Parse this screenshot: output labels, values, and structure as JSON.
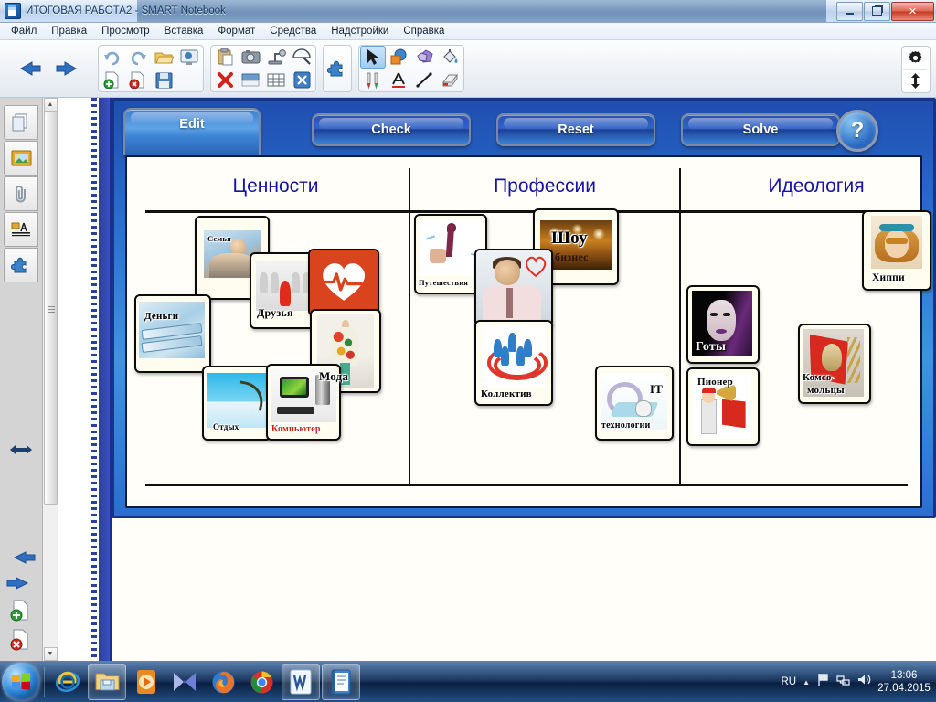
{
  "window": {
    "title": "ИТОГОВАЯ РАБОТА2 - SMART Notebook",
    "app_icon": "notebook-icon",
    "minimize": "–",
    "restore": "❐",
    "close": "✕"
  },
  "menu": {
    "items": [
      {
        "label": "Файл"
      },
      {
        "label": "Правка"
      },
      {
        "label": "Просмотр"
      },
      {
        "label": "Вставка"
      },
      {
        "label": "Формат"
      },
      {
        "label": "Средства"
      },
      {
        "label": "Надстройки"
      },
      {
        "label": "Справка"
      }
    ]
  },
  "toolbar": {
    "groups": [
      {
        "name": "navigation",
        "buttons": [
          "previous-page-arrow",
          "next-page-arrow"
        ]
      },
      {
        "name": "file",
        "buttons": [
          "undo",
          "redo",
          "open",
          "add-page",
          "delete-page",
          "save"
        ]
      },
      {
        "name": "view",
        "buttons": [
          "screen-shade",
          "full-screen"
        ]
      },
      {
        "name": "insert",
        "buttons": [
          "paste",
          "screen-capture",
          "document-camera",
          "measurement-tools",
          "delete",
          "show-hide-screen-shade",
          "table",
          "smart-exchange"
        ]
      },
      {
        "name": "addons",
        "buttons": [
          "add-ons-puzzle"
        ]
      },
      {
        "name": "tools",
        "buttons": [
          "select",
          "shapes",
          "regular-polygons",
          "fill",
          "pens",
          "text",
          "lines",
          "eraser"
        ]
      }
    ],
    "corner": [
      "customize-toolbar-gear",
      "move-toolbar-updown"
    ]
  },
  "sidebar": {
    "tabs": [
      {
        "name": "page-sorter",
        "icon": "pages-icon"
      },
      {
        "name": "gallery",
        "icon": "picture-frame-icon"
      },
      {
        "name": "attachments",
        "icon": "paperclip-icon"
      },
      {
        "name": "properties",
        "icon": "text-properties-icon"
      },
      {
        "name": "add-ons",
        "icon": "puzzle-piece-icon"
      }
    ],
    "resize_handle": "horizontal-resize-icon",
    "bottom": [
      {
        "name": "previous-page",
        "icon": "left-arrow-icon"
      },
      {
        "name": "next-page",
        "icon": "right-arrow-icon"
      },
      {
        "name": "add-page",
        "icon": "page-plus-icon"
      },
      {
        "name": "delete-page",
        "icon": "page-delete-icon"
      }
    ]
  },
  "lesson": {
    "tabs": [
      {
        "label": "Edit",
        "active": true
      },
      {
        "label": "Check",
        "active": false
      },
      {
        "label": "Reset",
        "active": false
      },
      {
        "label": "Solve",
        "active": false
      }
    ],
    "help_label": "?",
    "columns": [
      {
        "title": "Ценности"
      },
      {
        "title": "Профессии"
      },
      {
        "title": "Идеология"
      }
    ],
    "cards": [
      {
        "label": "Семья",
        "art": "t-family",
        "column": 1
      },
      {
        "label": "Друзья",
        "art": "t-friends",
        "column": 1
      },
      {
        "label": "",
        "art": "t-heart",
        "column": 1
      },
      {
        "label": "Деньги",
        "art": "t-money",
        "column": 1
      },
      {
        "label": "Мода",
        "art": "t-moda",
        "column": 1
      },
      {
        "label": "Отдых",
        "art": "t-otdyh",
        "column": 1
      },
      {
        "label": "Компьютер",
        "art": "t-comp",
        "column": 1
      },
      {
        "label": "Путешествия",
        "art": "t-travel",
        "column": 2
      },
      {
        "label": "Шоу-бизнес",
        "art": "t-show",
        "column": 2
      },
      {
        "label": "",
        "art": "t-man",
        "column": 2
      },
      {
        "label": "Коллектив",
        "art": "t-team",
        "column": 2
      },
      {
        "label": "IT технологии",
        "art": "t-it",
        "column": 2
      },
      {
        "label": "Хиппи",
        "art": "t-hippie",
        "column": 3
      },
      {
        "label": "Готы",
        "art": "t-goth",
        "column": 3
      },
      {
        "label": "Комсо-мольцы",
        "art": "t-komsomol",
        "column": 3
      },
      {
        "label": "Пионер",
        "art": "t-pioneer",
        "column": 3
      }
    ],
    "card_text": {
      "family": "Семья",
      "friends": "Друзья",
      "money": "Деньги",
      "moda": "Мода",
      "otdyh": "Отдых",
      "computer": "Компьютер",
      "travel": "Путешествия",
      "show_line1": "Шоу",
      "show_line2": "бизнес",
      "team": "Коллектив",
      "it_line1": "IT",
      "it_line2": "технологии",
      "hippie": "Хиппи",
      "goth": "Готы",
      "komsomol_line1": "Комсо-",
      "komsomol_line2": "мольцы",
      "pioneer": "Пионер"
    }
  },
  "taskbar": {
    "start": "windows-start-orb",
    "items": [
      {
        "name": "internet-explorer",
        "icon": "ie-icon"
      },
      {
        "name": "windows-explorer",
        "icon": "folder-icon"
      },
      {
        "name": "windows-media-player",
        "icon": "media-player-icon"
      },
      {
        "name": "movie-maker",
        "icon": "movie-maker-icon"
      },
      {
        "name": "mozilla-firefox",
        "icon": "firefox-icon"
      },
      {
        "name": "google-chrome",
        "icon": "chrome-icon"
      },
      {
        "name": "microsoft-word",
        "icon": "word-icon"
      },
      {
        "name": "smart-notebook",
        "icon": "notebook-icon"
      }
    ],
    "tray": {
      "language": "RU",
      "show_hidden": "▲",
      "icons": [
        "flag-icon",
        "network-icon",
        "volume-icon"
      ]
    },
    "clock": {
      "time": "13:06",
      "date": "27.04.2015"
    }
  },
  "colors": {
    "title_accent": "#14385e",
    "lesson_blue": "#2a6fd0",
    "column_heading": "#1414aa",
    "card_bg": "#fffdf0",
    "taskbar": "#0c2a54"
  }
}
